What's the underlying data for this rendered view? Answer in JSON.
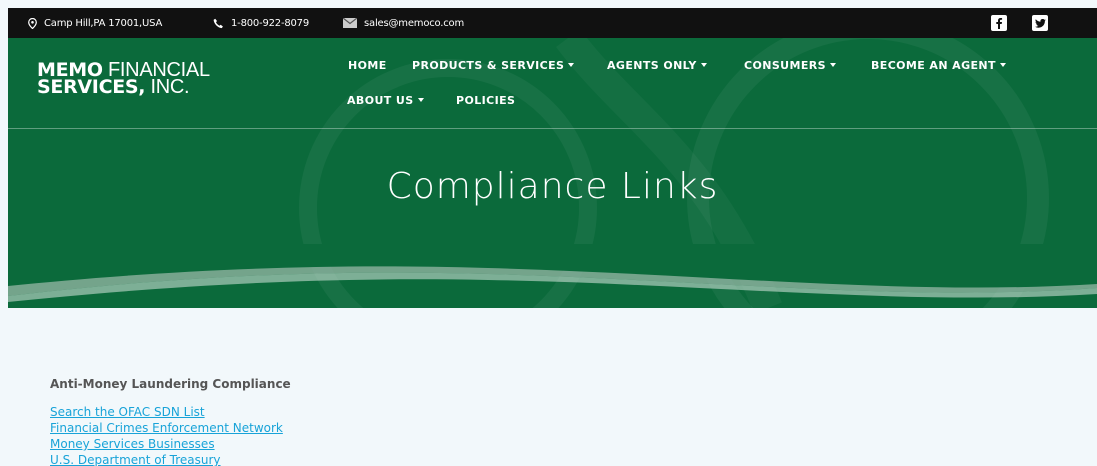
{
  "topbar": {
    "address": "Camp Hill,PA 17001,USA",
    "phone": "1-800-922-8079",
    "email": "sales@memoco.com",
    "social": {
      "facebook_icon": "f",
      "twitter_icon": "twitter"
    }
  },
  "logo": {
    "bold1": "MEMO",
    "thin1": " FINANCIAL",
    "bold2": "SERVICES,",
    "thin2": " INC."
  },
  "nav": {
    "home": "HOME",
    "products": "PRODUCTS & SERVICES",
    "agents": "AGENTS ONLY",
    "consumers": "CONSUMERS",
    "become": "BECOME AN AGENT",
    "about": "ABOUT US",
    "policies": "POLICIES"
  },
  "hero": {
    "title": "Compliance Links"
  },
  "content": {
    "heading": "Anti-Money Laundering Compliance",
    "links": [
      "Search the OFAC SDN List",
      "Financial Crimes Enforcement Network",
      "Money Services Businesses",
      "U.S. Department of Treasury"
    ]
  },
  "colors": {
    "brand_green": "#0b6a3b",
    "link_blue": "#18a3d8",
    "topbar": "#111111",
    "page_bg": "#f2f8fb"
  }
}
